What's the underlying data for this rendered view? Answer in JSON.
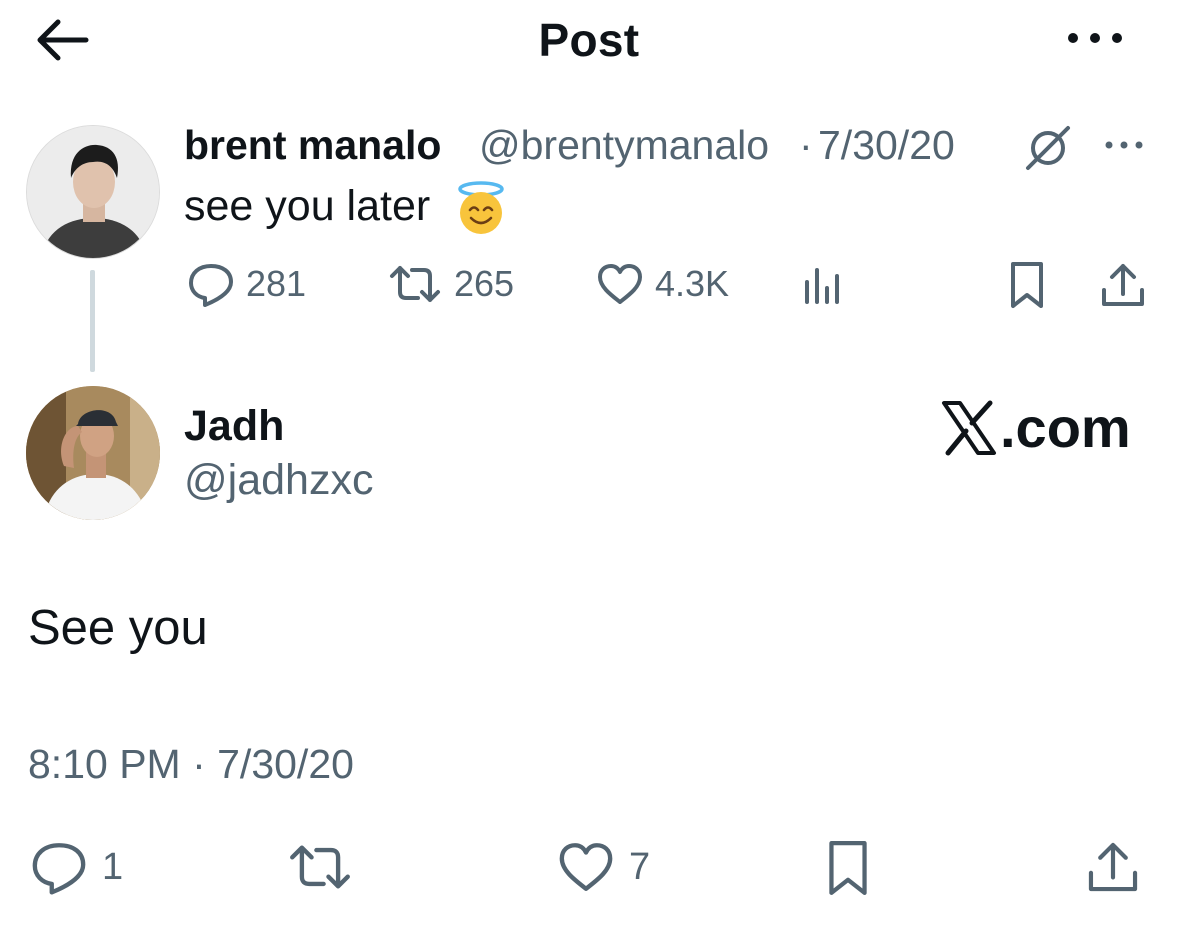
{
  "header": {
    "title": "Post",
    "back_icon": "arrow-left-icon",
    "more_icon": "more-horizontal-icon"
  },
  "parent_post": {
    "author_name": "brent manalo",
    "author_handle": "@brentymanalo",
    "separator": "·",
    "date": "7/30/20",
    "text": "see you later",
    "emoji": "smiling-face-with-halo",
    "status_icon": "hidden-reply-icon",
    "stats": {
      "replies": "281",
      "reposts": "265",
      "likes": "4.3K"
    }
  },
  "reply_post": {
    "author_name": "Jadh",
    "author_handle": "@jadhzxc",
    "text": "See you",
    "timestamp": "8:10 PM · 7/30/20",
    "stats": {
      "replies": "1",
      "likes": "7"
    }
  },
  "watermark": {
    "mark": "𝕏",
    "text": ".com"
  },
  "colors": {
    "text_primary": "#0f1419",
    "text_secondary": "#536471",
    "thread_line": "#cfd9de"
  }
}
